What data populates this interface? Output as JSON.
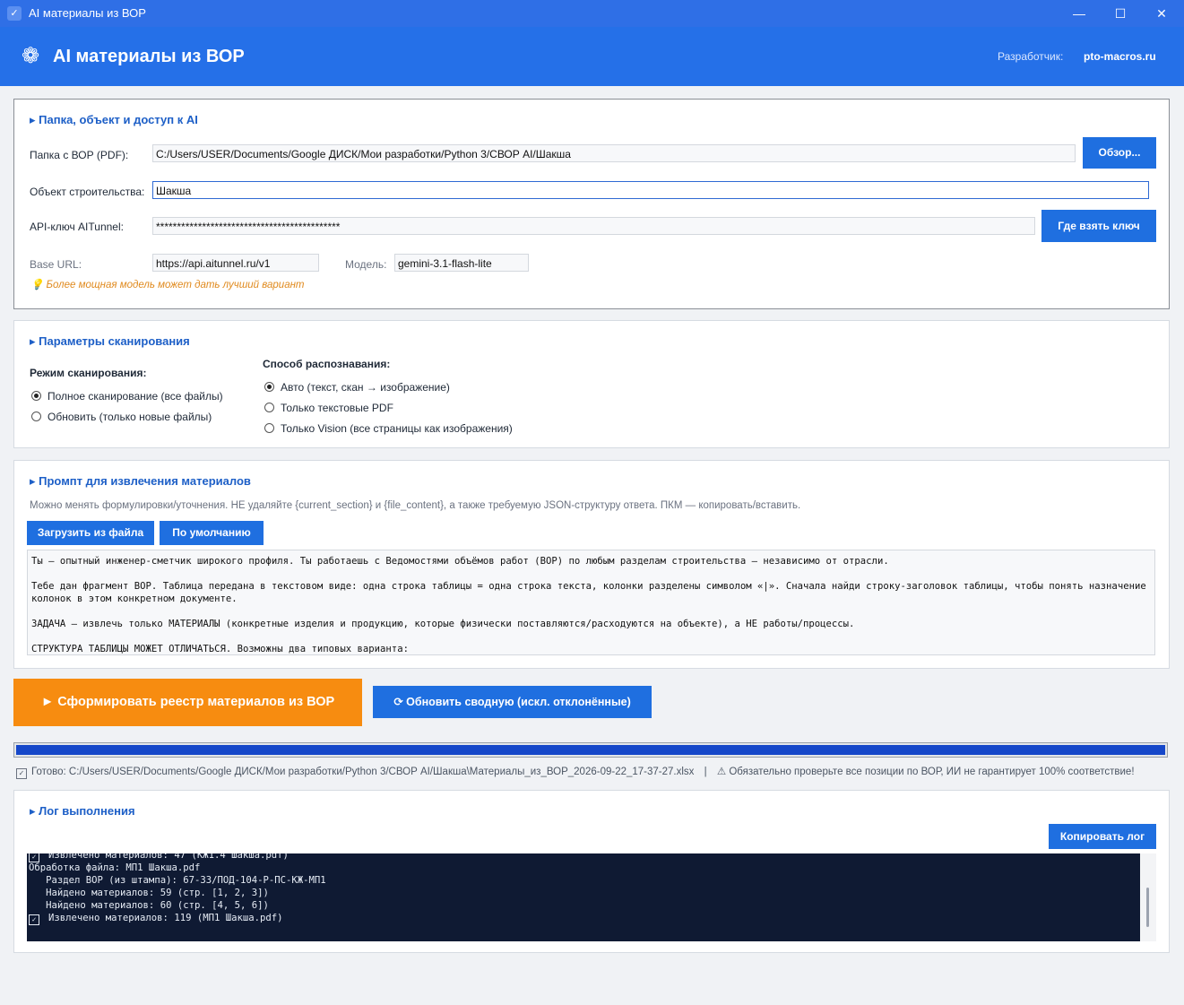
{
  "window": {
    "title": "AI материалы из ВОР",
    "min": "—",
    "max": "☐",
    "close": "✕",
    "app_icon": "✓"
  },
  "header": {
    "logo_glyph": "❁",
    "title": "AI материалы из ВОР",
    "developer_label": "Разработчик:",
    "developer_value": "pto-macros.ru"
  },
  "access": {
    "section_title": "▸ Папка, объект и доступ к AI",
    "folder_label": "Папка с ВОР (PDF):",
    "folder_value": "C:/Users/USER/Documents/Google ДИСК/Мои разработки/Python 3/СВОР AI/Шакша",
    "browse_button": "Обзор...",
    "object_label": "Объект строительства:",
    "object_value": "Шакша",
    "api_label": "API-ключ AITunnel:",
    "api_value": "********************************************",
    "get_key_button": "Где взять ключ",
    "base_url_label": "Base URL:",
    "base_url_value": "https://api.aitunnel.ru/v1",
    "model_label": "Модель:",
    "model_value": "gemini-3.1-flash-lite",
    "hint": "💡 Более мощная модель может дать лучший вариант"
  },
  "scan": {
    "section_title": "▸ Параметры сканирования",
    "mode_label": "Режим сканирования:",
    "mode_options": [
      "Полное сканирование (все файлы)",
      "Обновить (только новые файлы)"
    ],
    "recog_label": "Способ распознавания:",
    "recog_options": [
      "Авто (текст, скан → изображение)",
      "Только текстовые PDF",
      "Только Vision (все страницы как изображения)"
    ]
  },
  "prompt": {
    "section_title": "▸ Промпт для извлечения материалов",
    "note": "Можно менять формулировки/уточнения. НЕ удаляйте {current_section} и {file_content}, а также требуемую JSON-структуру ответа. ПКМ — копировать/вставить.",
    "load_button": "Загрузить из файла",
    "default_button": "По умолчанию",
    "text": "Ты — опытный инженер-сметчик широкого профиля. Ты работаешь с Ведомостями объёмов работ (ВОР) по любым разделам строительства — независимо от отрасли.\n\nТебе дан фрагмент ВОР. Таблица передана в текстовом виде: одна строка таблицы = одна строка текста, колонки разделены символом «|». Сначала найди строку-заголовок таблицы, чтобы понять назначение колонок в этом конкретном документе.\n\nЗАДАЧА — извлечь только МАТЕРИАЛЫ (конкретные изделия и продукцию, которые физически поставляются/расходуются на объекте), а НЕ работы/процессы.\n\nСТРУКТУРА ТАБЛИЦЫ МОЖЕТ ОТЛИЧАТЬСЯ. Возможны два типовых варианта:"
  },
  "actions": {
    "generate_button": "►  Сформировать реестр материалов из ВОР",
    "refresh_button": "⟳  Обновить сводную (искл. отклонённые)"
  },
  "progress": {
    "value": 1.0
  },
  "status": {
    "check_glyph": "✓",
    "done_text": "Готово: C:/Users/USER/Documents/Google ДИСК/Мои разработки/Python 3/СВОР AI/Шакша\\Материалы_из_ВОР_2026-09-22_17-37-27.xlsx",
    "separator": "|",
    "warning": "⚠  Обязательно проверьте все позиции по ВОР, ИИ не гарантирует 100% соответствие!"
  },
  "log": {
    "section_title": "▸ Лог выполнения",
    "copy_button": "Копировать лог",
    "check_glyph": "✓",
    "lines": [
      {
        "check": true,
        "text": "Извлечено материалов: 47 (КЖ1.4 Шакша.pdf)"
      },
      {
        "check": false,
        "text": "Обработка файла: МП1 Шакша.pdf"
      },
      {
        "check": false,
        "text": "   Раздел ВОР (из штампа): 67-33/ПОД-104-Р-ПС-КЖ-МП1"
      },
      {
        "check": false,
        "text": "   Найдено материалов: 59 (стр. [1, 2, 3])"
      },
      {
        "check": false,
        "text": "   Найдено материалов: 60 (стр. [4, 5, 6])"
      },
      {
        "check": true,
        "text": "Извлечено материалов: 119 (МП1 Шакша.pdf)"
      }
    ]
  }
}
